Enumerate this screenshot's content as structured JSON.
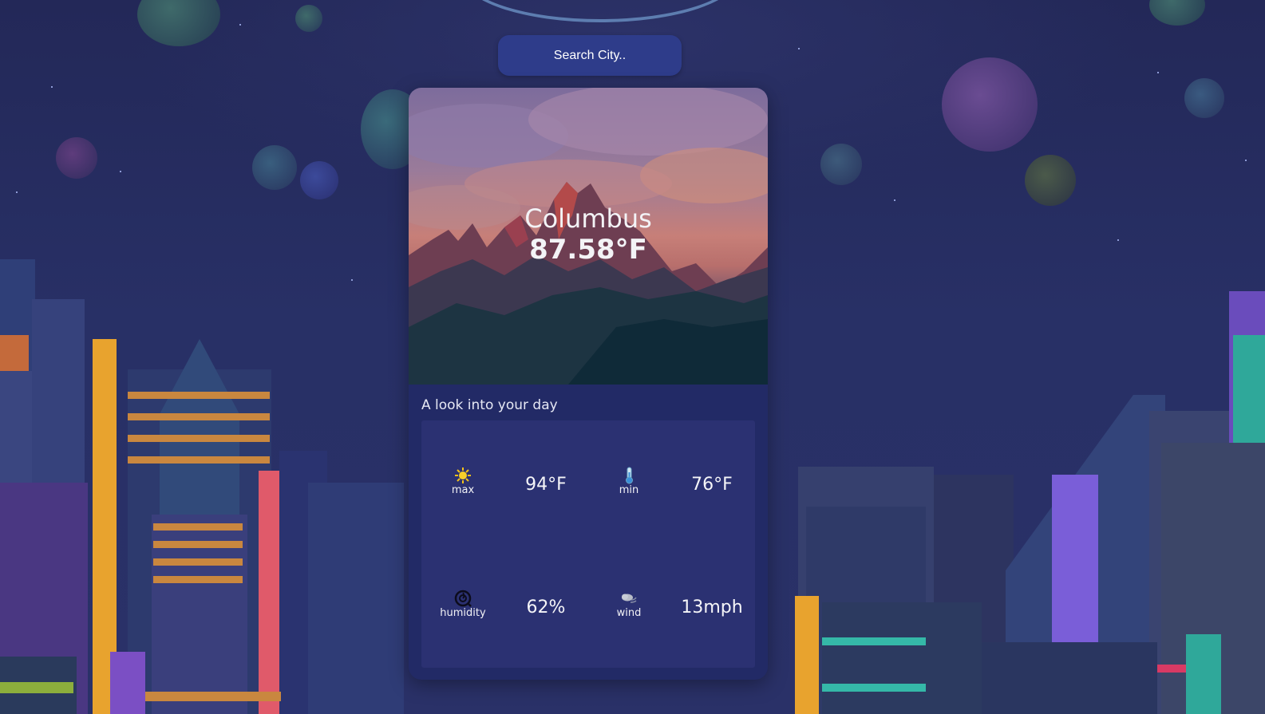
{
  "search": {
    "placeholder": "Search City.."
  },
  "weather": {
    "city": "Columbus",
    "temperature": "87.58°F"
  },
  "day": {
    "heading": "A look into your day",
    "max": {
      "label": "max",
      "value": "94°F",
      "icon": "sun-icon"
    },
    "min": {
      "label": "min",
      "value": "76°F",
      "icon": "thermometer-icon"
    },
    "humidity": {
      "label": "humidity",
      "value": "62%",
      "icon": "humidity-icon"
    },
    "wind": {
      "label": "wind",
      "value": "13mph",
      "icon": "wind-icon"
    }
  },
  "colors": {
    "card_bg": "#222a66",
    "panel_bg": "#2b3172",
    "search_bg": "#2e3c8a",
    "page_bg": "#24295a"
  }
}
